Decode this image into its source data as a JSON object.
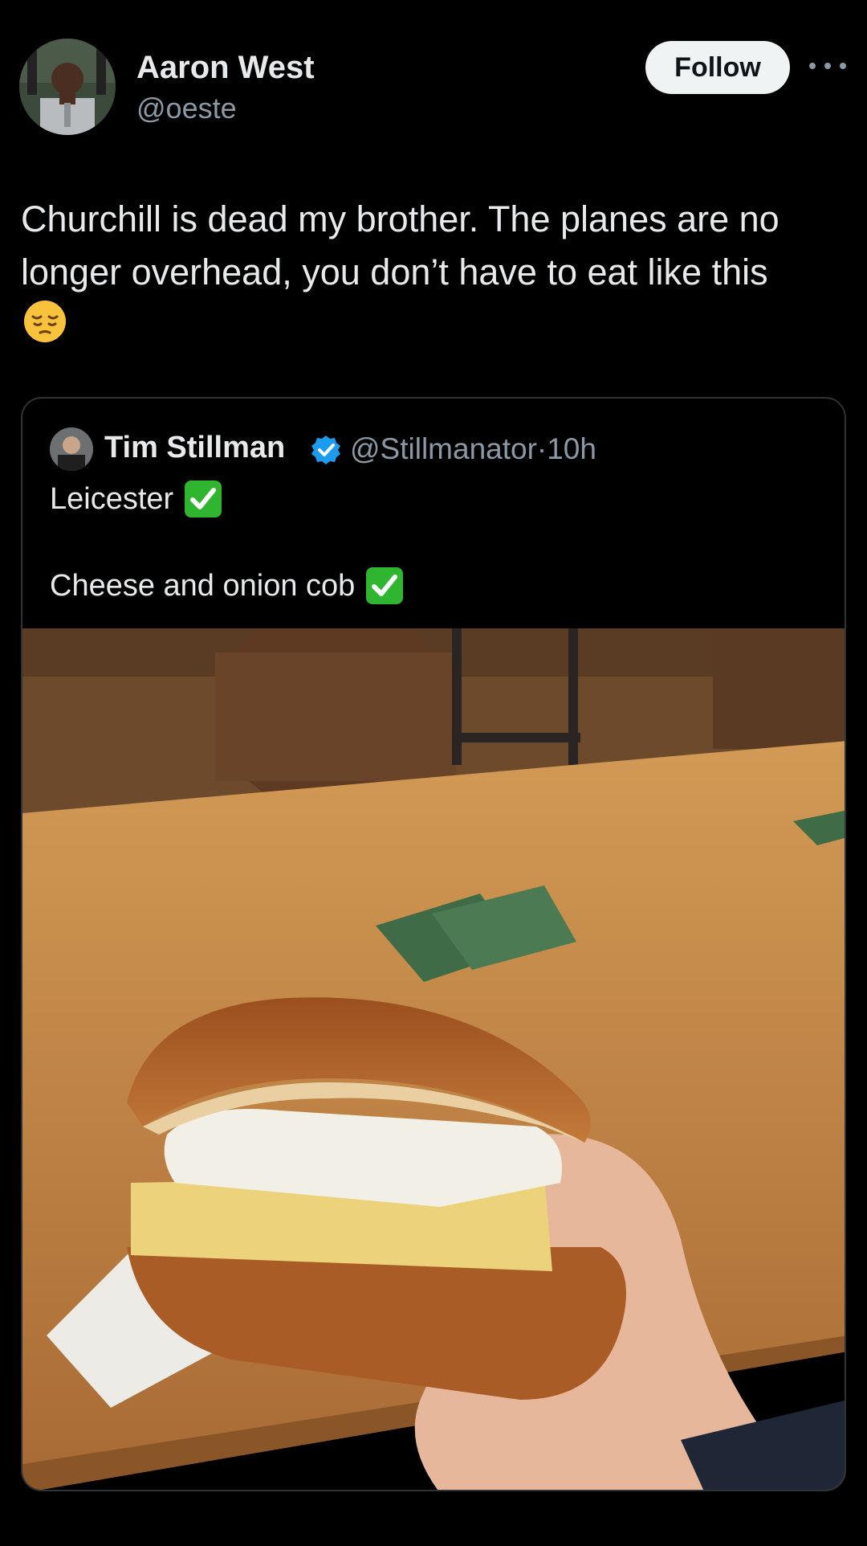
{
  "post": {
    "author_name": "Aaron West",
    "author_handle": "@oeste",
    "follow_label": "Follow",
    "more_icon": "more-horizontal-icon",
    "text": "Churchill is dead my brother. The planes are no longer overhead, you don’t have to eat like this",
    "emoji": "pensive-face-emoji"
  },
  "quote": {
    "author_name": "Tim Stillman",
    "verified_icon": "verified-badge-icon",
    "author_handle_time": "@Stillmanator·10h",
    "line1": "Leicester",
    "line2": "Cheese and onion cob",
    "check_icon": "check-mark-button-emoji",
    "image": "photo of a cheese and onion bread roll held over a wooden pub table"
  },
  "colors": {
    "background": "#000000",
    "text_primary": "#e7e9ea",
    "text_secondary": "#8b98a5",
    "follow_bg": "#eff3f4",
    "border": "#2f3336",
    "verified_blue": "#1d9bf0",
    "check_green": "#2fb52f"
  }
}
